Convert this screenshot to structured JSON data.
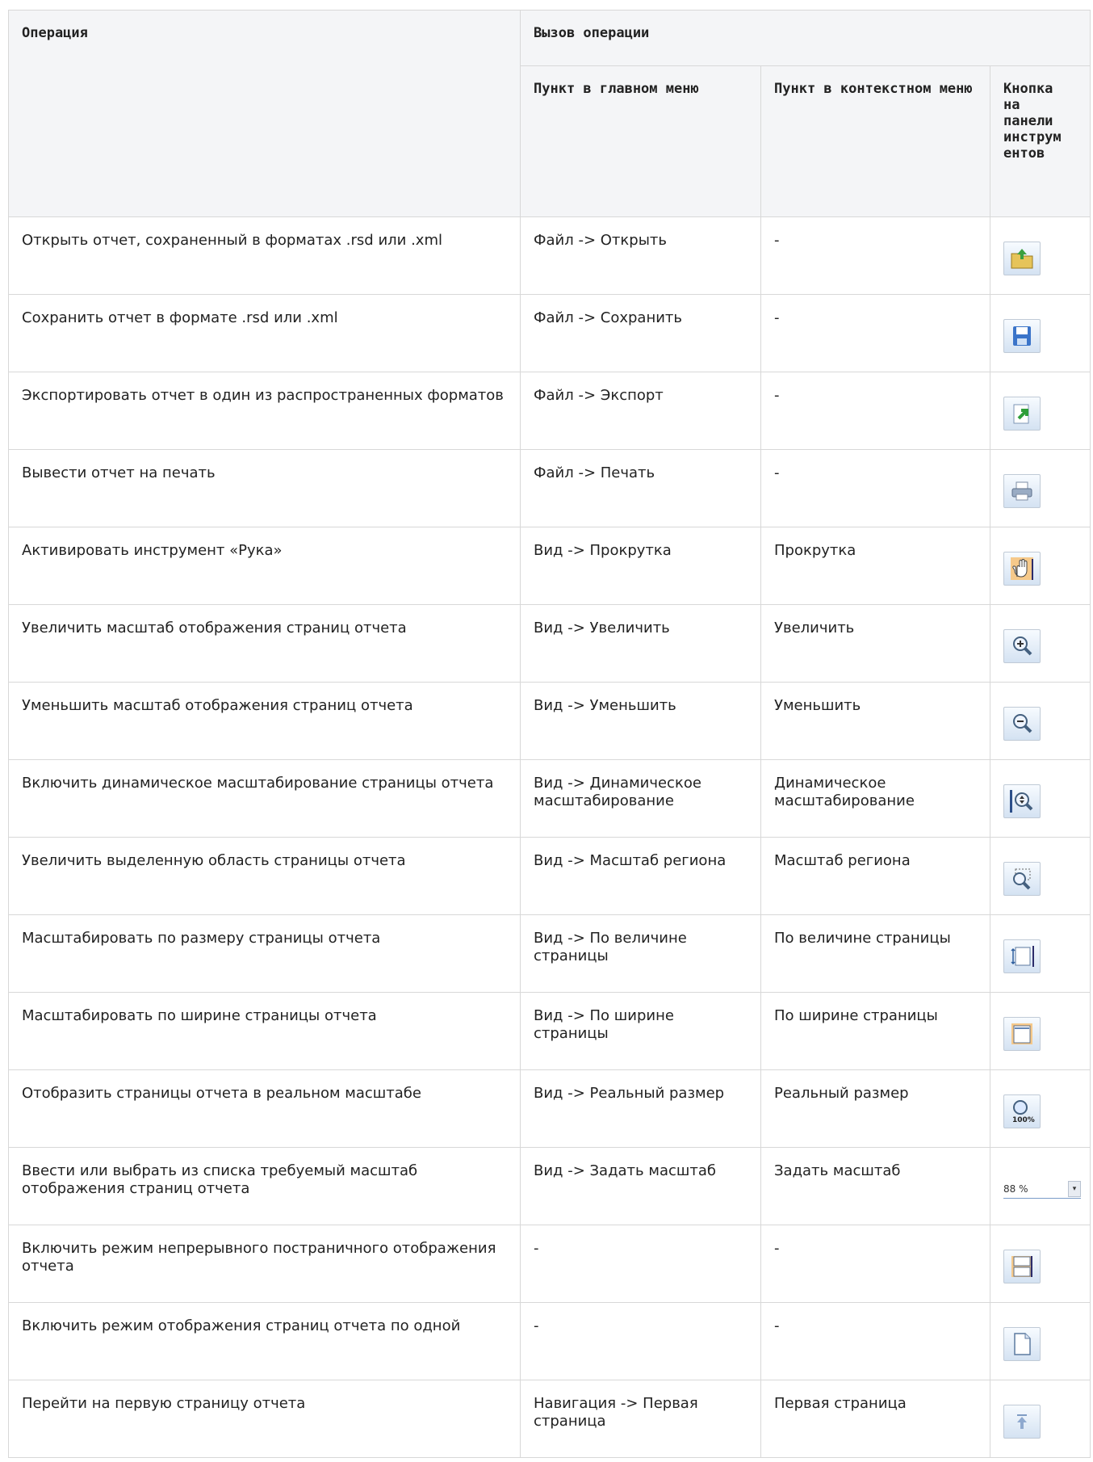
{
  "header": {
    "operation": "Операция",
    "invocation": "Вызов операции",
    "main_menu": "Пункт в главном меню",
    "context_menu": "Пункт в контекстном меню",
    "toolbar_button": "Кнопка на панели инструм ентов"
  },
  "rows": [
    {
      "operation": "Открыть отчет, сохраненный в форматах .rsd или .xml",
      "main_menu": "Файл -> Открыть",
      "context_menu": "-",
      "icon": "open-folder-icon"
    },
    {
      "operation": "Сохранить отчет в формате .rsd или .xml",
      "main_menu": "Файл -> Сохранить",
      "context_menu": "-",
      "icon": "save-disk-icon"
    },
    {
      "operation": "Экспортировать отчет в один из распространенных форматов",
      "main_menu": "Файл -> Экспорт",
      "context_menu": "-",
      "icon": "export-icon"
    },
    {
      "operation": "Вывести отчет на печать",
      "main_menu": "Файл -> Печать",
      "context_menu": "-",
      "icon": "printer-icon"
    },
    {
      "operation": "Активировать инструмент «Рука»",
      "main_menu": "Вид -> Прокрутка",
      "context_menu": "Прокрутка",
      "icon": "hand-icon"
    },
    {
      "operation": "Увеличить масштаб отображения страниц отчета",
      "main_menu": "Вид -> Увеличить",
      "context_menu": "Увеличить",
      "icon": "zoom-in-icon"
    },
    {
      "operation": "Уменьшить масштаб отображения страниц отчета",
      "main_menu": "Вид -> Уменьшить",
      "context_menu": "Уменьшить",
      "icon": "zoom-out-icon"
    },
    {
      "operation": "Включить динамическое масштабирование страницы отчета",
      "main_menu": "Вид -> Динамическое масштабирование",
      "context_menu": "Динамическое масштабирование",
      "icon": "dynamic-zoom-icon"
    },
    {
      "operation": "Увеличить выделенную область страницы отчета",
      "main_menu": "Вид -> Масштаб региона",
      "context_menu": "Масштаб региона",
      "icon": "zoom-region-icon"
    },
    {
      "operation": "Масштабировать по размеру страницы отчета",
      "main_menu": "Вид -> По величине страницы",
      "context_menu": "По величине страницы",
      "icon": "fit-page-icon"
    },
    {
      "operation": "Масштабировать по ширине страницы отчета",
      "main_menu": "Вид -> По ширине страницы",
      "context_menu": "По ширине страницы",
      "icon": "fit-width-icon"
    },
    {
      "operation": "Отобразить страницы отчета в реальном масштабе",
      "main_menu": "Вид -> Реальный размер",
      "context_menu": "Реальный размер",
      "icon": "actual-size-icon",
      "icon_text": "100%"
    },
    {
      "operation": "Ввести или выбрать из списка требуемый масштаб отображения страниц отчета",
      "main_menu": "Вид -> Задать масштаб",
      "context_menu": "Задать масштаб",
      "icon": "zoom-select",
      "icon_text": "88 %"
    },
    {
      "operation": "Включить режим непрерывного постраничного отображения отчета",
      "main_menu": "-",
      "context_menu": "-",
      "icon": "continuous-pages-icon"
    },
    {
      "operation": "Включить режим отображения страниц отчета по одной",
      "main_menu": "-",
      "context_menu": "-",
      "icon": "single-page-icon"
    },
    {
      "operation": "Перейти на первую страницу отчета",
      "main_menu": "Навигация -> Первая страница",
      "context_menu": "Первая страница",
      "icon": "first-page-icon"
    }
  ]
}
